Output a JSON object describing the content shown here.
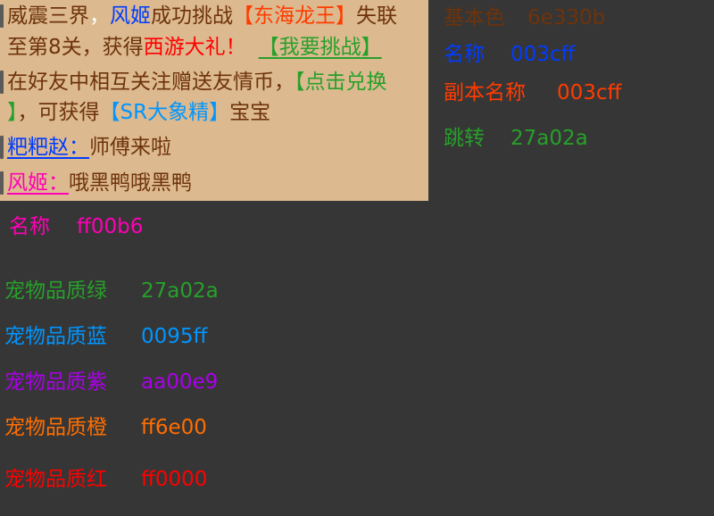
{
  "colors": {
    "background": "#363636",
    "panel": "#dcb98f",
    "base": "#6e330b",
    "name": "#003cff",
    "dungeon_name": "#ff3c00",
    "jump": "#27a02a",
    "name_pink": "#ff00b6",
    "gift_red": "#ff0000",
    "pet_blue": "#0095ff"
  },
  "chat": {
    "msg1": {
      "prefix": "威震三界",
      "comma": "，",
      "player": "风姬",
      "action": "成功挑战",
      "boss": "【东海龙王】",
      "rest1": "失联",
      "rest2": "至第8关，获得",
      "gift": "西游大礼！",
      "link": "【我要挑战】"
    },
    "msg2": {
      "text1": "在好友中相互关注赠送友情币，",
      "link_a": "【点击兑换",
      "link_b": "】",
      "text2": "，可获得",
      "pet": "【SR大象精】",
      "text3": "宝宝"
    },
    "msg3": {
      "sender": "粑粑赵：",
      "text": "师傅来啦"
    },
    "msg4": {
      "sender": "风姬：",
      "text": "哦黑鸭哦黑鸭"
    }
  },
  "legend_right": [
    {
      "label": "基本色",
      "value": "6e330b"
    },
    {
      "label": "名称",
      "value": "003cff"
    },
    {
      "label": "副本名称",
      "value": "003cff"
    },
    {
      "label": "跳转",
      "value": "27a02a"
    }
  ],
  "legend_left": {
    "name_pink": {
      "label": "名称",
      "value": "ff00b6"
    },
    "pets": [
      {
        "label": "宠物品质绿",
        "value": "27a02a",
        "color": "#27a02a"
      },
      {
        "label": "宠物品质蓝",
        "value": "0095ff",
        "color": "#0095ff"
      },
      {
        "label": "宠物品质紫",
        "value": "aa00e9",
        "color": "#aa00e9"
      },
      {
        "label": "宠物品质橙",
        "value": "ff6e00",
        "color": "#ff6e00"
      },
      {
        "label": "宠物品质红",
        "value": "ff0000",
        "color": "#ff0000"
      }
    ]
  }
}
